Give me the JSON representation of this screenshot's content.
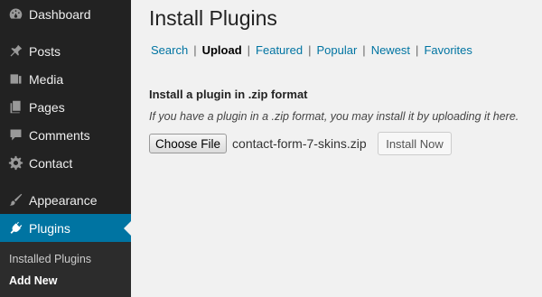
{
  "sidebar": {
    "items": [
      {
        "label": "Dashboard",
        "icon": "dashboard-icon"
      },
      {
        "label": "Posts",
        "icon": "pin-icon"
      },
      {
        "label": "Media",
        "icon": "media-icon"
      },
      {
        "label": "Pages",
        "icon": "pages-icon"
      },
      {
        "label": "Comments",
        "icon": "comment-icon"
      },
      {
        "label": "Contact",
        "icon": "gear-icon"
      },
      {
        "label": "Appearance",
        "icon": "brush-icon"
      },
      {
        "label": "Plugins",
        "icon": "plug-icon",
        "active": true
      }
    ],
    "submenu": [
      {
        "label": "Installed Plugins"
      },
      {
        "label": "Add New",
        "current": true
      }
    ]
  },
  "page": {
    "title": "Install Plugins",
    "tabs": [
      "Search",
      "Upload",
      "Featured",
      "Popular",
      "Newest",
      "Favorites"
    ],
    "current_tab": "Upload",
    "section_title": "Install a plugin in .zip format",
    "description": "If you have a plugin in a .zip format, you may install it by uploading it here.",
    "choose_file_label": "Choose File",
    "file_name": "contact-form-7-skins.zip",
    "install_button": "Install Now"
  },
  "colors": {
    "sidebar_bg": "#222222",
    "active_bg": "#0074a2",
    "link": "#0074a2",
    "page_bg": "#f1f1f1"
  }
}
